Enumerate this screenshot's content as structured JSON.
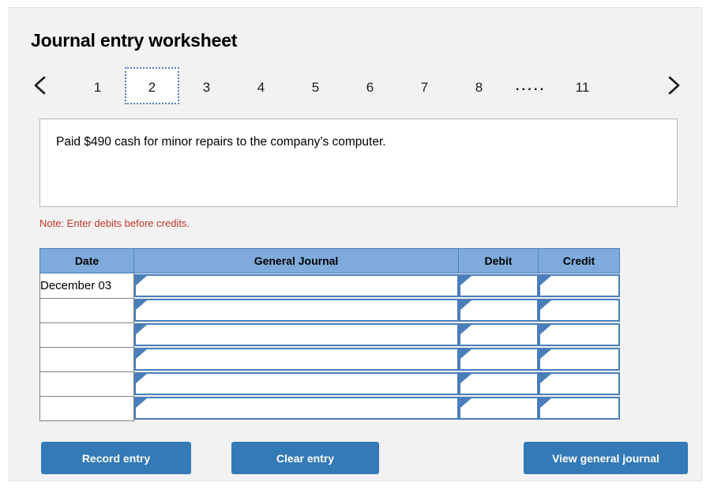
{
  "title": "Journal entry worksheet",
  "pager": {
    "prev_icon": "chevron-left-icon",
    "next_icon": "chevron-right-icon",
    "tabs": [
      "1",
      "2",
      "3",
      "4",
      "5",
      "6",
      "7",
      "8"
    ],
    "ellipsis": ".....",
    "last_tab": "11",
    "selected": "2"
  },
  "prompt": "Paid $490 cash for minor repairs to the company’s computer.",
  "note": "Note: Enter debits before credits.",
  "table": {
    "headers": {
      "date": "Date",
      "general_journal": "General Journal",
      "debit": "Debit",
      "credit": "Credit"
    },
    "rows": [
      {
        "date": "December 03",
        "account": "",
        "debit": "",
        "credit": ""
      },
      {
        "date": "",
        "account": "",
        "debit": "",
        "credit": ""
      },
      {
        "date": "",
        "account": "",
        "debit": "",
        "credit": ""
      },
      {
        "date": "",
        "account": "",
        "debit": "",
        "credit": ""
      },
      {
        "date": "",
        "account": "",
        "debit": "",
        "credit": ""
      },
      {
        "date": "",
        "account": "",
        "debit": "",
        "credit": ""
      }
    ]
  },
  "buttons": {
    "record": "Record entry",
    "clear": "Clear entry",
    "view": "View general journal"
  },
  "colors": {
    "accent_blue": "#337ab7",
    "header_blue": "#7eabdc",
    "field_border": "#4a7ebb",
    "note_red": "#c0392b",
    "panel_bg": "#f2f2f2"
  }
}
